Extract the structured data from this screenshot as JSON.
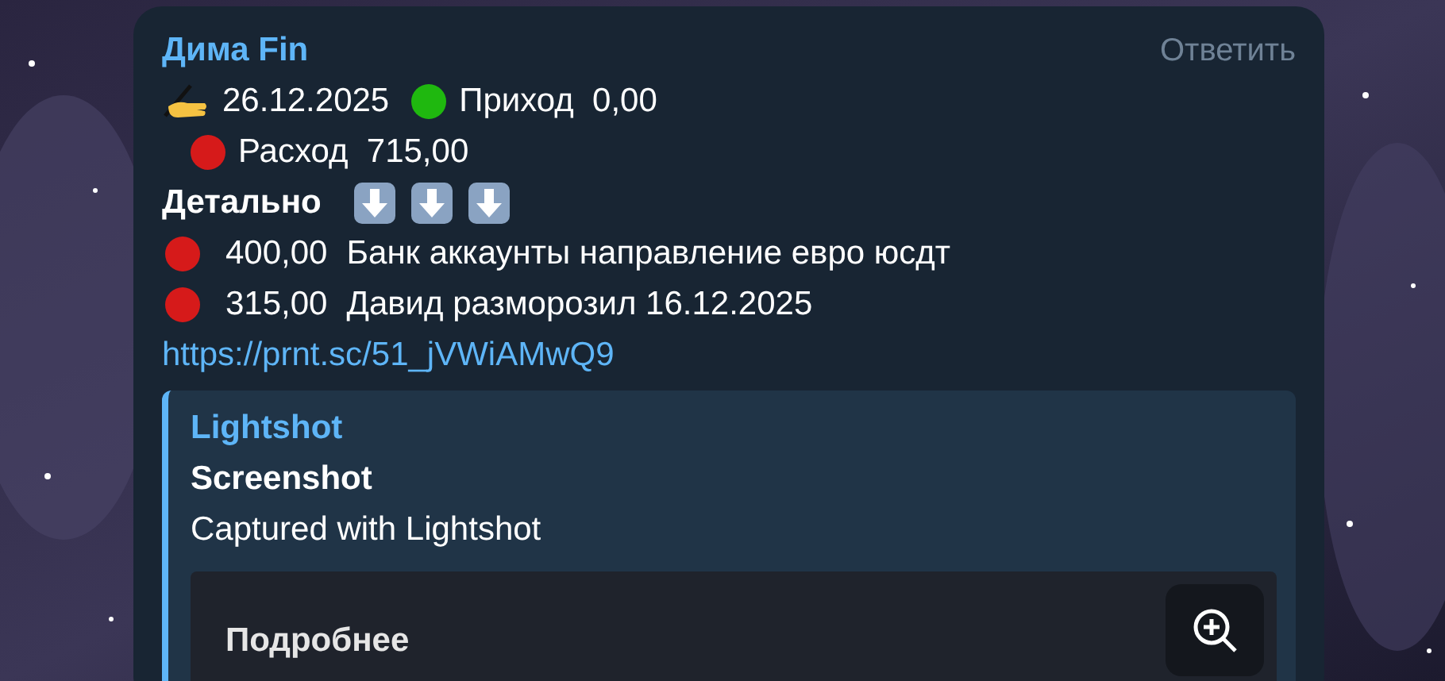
{
  "message": {
    "sender": "Дима Fin",
    "reply_action": "Ответить",
    "date": "26.12.2025",
    "summary": [
      {
        "color": "#1fb80f",
        "text": "Приход  0,00"
      },
      {
        "color": "#d61a1a",
        "text": "Расход  715,00"
      }
    ],
    "details_heading": "Детально",
    "entries": [
      {
        "color": "#d61a1a",
        "amount": "400,00",
        "text": "Банк аккаунты направление евро юсдт"
      },
      {
        "color": "#d61a1a",
        "amount": "315,00",
        "text": "Давид разморозил 16.12.2025"
      }
    ],
    "link": "https://prnt.sc/51_jVWiAMwQ9",
    "preview": {
      "site": "Lightshot",
      "title": "Screenshot",
      "description": "Captured with Lightshot",
      "image_button": "Подробнее"
    }
  }
}
